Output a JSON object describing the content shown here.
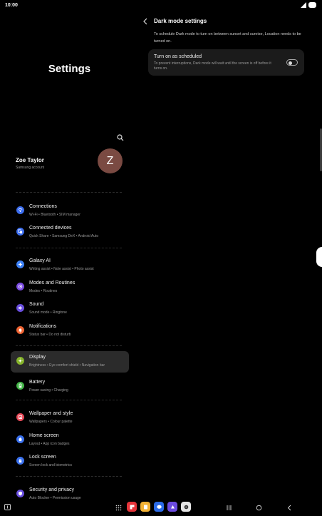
{
  "status_bar": {
    "time": "10:00",
    "icons": [
      "signal-icon",
      "battery-icon"
    ]
  },
  "left": {
    "title": "Settings",
    "profile": {
      "name": "Zoe Taylor",
      "sub": "Samsung account",
      "avatar_letter": "Z",
      "avatar_color": "#7a4a42"
    },
    "items": [
      {
        "title": "Connections",
        "sub": "Wi-Fi  •  Bluetooth  •  SIM manager",
        "icon": "wifi-icon",
        "color": "#3c6ef0"
      },
      {
        "title": "Connected devices",
        "sub": "Quick Share  •  Samsung DeX  •  Android Auto",
        "icon": "devices-icon",
        "color": "#3c6ef0"
      },
      {
        "title": "Galaxy AI",
        "sub": "Writing assist  •  Note assist  •  Photo assist",
        "icon": "ai-star-icon",
        "color": "#3d82f7"
      },
      {
        "title": "Modes and Routines",
        "sub": "Modes  •  Routines",
        "icon": "modes-icon",
        "color": "#7b4be3"
      },
      {
        "title": "Sound",
        "sub": "Sound mode  •  Ringtone",
        "icon": "speaker-icon",
        "color": "#6a4fe0"
      },
      {
        "title": "Notifications",
        "sub": "Status bar  •  Do not disturb",
        "icon": "bell-icon",
        "color": "#f06433"
      },
      {
        "title": "Display",
        "sub": "Brightness  •  Eye comfort shield  •  Navigation bar",
        "icon": "sun-icon",
        "color": "#86b52b"
      },
      {
        "title": "Battery",
        "sub": "Power saving  •  Charging",
        "icon": "battery-setting-icon",
        "color": "#43b548"
      },
      {
        "title": "Wallpaper and style",
        "sub": "Wallpapers  •  Colour palette",
        "icon": "brush-icon",
        "color": "#e94b5a"
      },
      {
        "title": "Home screen",
        "sub": "Layout  •  App icon badges",
        "icon": "home-icon",
        "color": "#3a71ef"
      },
      {
        "title": "Lock screen",
        "sub": "Screen lock and biometrics",
        "icon": "lock-icon",
        "color": "#3a71ef"
      },
      {
        "title": "Security and privacy",
        "sub": "Auto Blocker  •  Permission usage",
        "icon": "shield-icon",
        "color": "#6a4fe0"
      }
    ]
  },
  "right": {
    "title": "Dark mode settings",
    "description": "To schedule Dark mode to turn on between sunset and sunrise, Location needs to be turned on.",
    "option": {
      "title": "Turn on as scheduled",
      "sub": "To prevent interruptions, Dark mode will wait until the screen is off before it turns on.",
      "toggle_on": false
    }
  },
  "nav": {
    "dock_apps": [
      {
        "icon": "flipboard-icon",
        "color": "#e5343a"
      },
      {
        "icon": "notes-icon",
        "color": "#f3b234"
      },
      {
        "icon": "messages-icon",
        "color": "#2b6be8"
      },
      {
        "icon": "gallery-icon",
        "color": "#6b4be0"
      },
      {
        "icon": "camera-icon",
        "color": "#e6e6e6"
      }
    ]
  }
}
